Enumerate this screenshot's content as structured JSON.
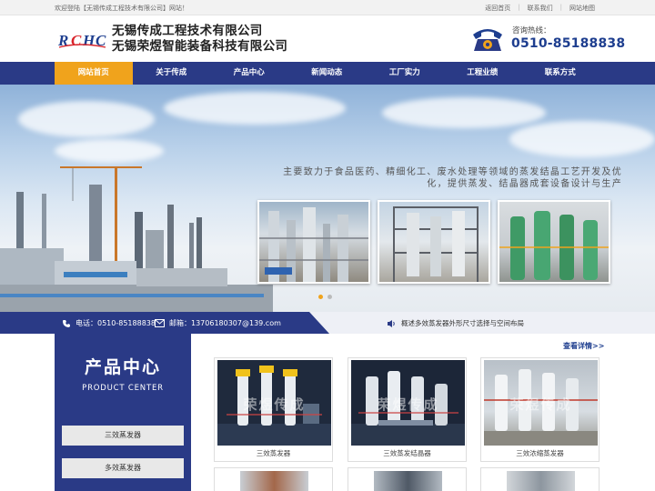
{
  "topbar": {
    "welcome": "欢迎登陆【无锡传成工程技术有限公司】网站！",
    "links": [
      "返回首页",
      "联系我们",
      "网站地图"
    ]
  },
  "header": {
    "logo_text": "RCHC",
    "company_line1": "无锡传成工程技术有限公司",
    "company_line2": "无锡荣煜智能装备科技有限公司",
    "hotline_label": "咨询热线：",
    "hotline_number": "0510-85188838"
  },
  "nav": {
    "items": [
      "网站首页",
      "关于传成",
      "产品中心",
      "新闻动态",
      "工厂实力",
      "工程业绩",
      "联系方式"
    ],
    "active_index": 0
  },
  "banner": {
    "slogan": "主要致力于食品医药、精细化工、废水处理等领域的蒸发结晶工艺开发及优化，提供蒸发、结晶器成套设备设计与生产",
    "slide_count": 2,
    "active_slide": 0
  },
  "contact_strip": {
    "tel": "电话：0510-85188838",
    "email": "邮箱：13706180307@139.com",
    "news": "概述多效蒸发器外形尺寸选择与空间布局"
  },
  "products": {
    "section_title": "产品中心",
    "section_title_en": "PRODUCT CENTER",
    "more_link": "查看详情>>",
    "categories": [
      "三效蒸发器",
      "多效蒸发器"
    ],
    "watermarks": [
      "荣煜传成",
      "荣煜传成",
      "荣煜传成"
    ],
    "items": [
      {
        "caption": "三效蒸发器"
      },
      {
        "caption": "三效蒸发结晶器"
      },
      {
        "caption": "三效浓缩蒸发器"
      }
    ]
  },
  "colors": {
    "brand_blue": "#2a3a86",
    "accent_orange": "#f0a31c",
    "logo_red": "#d8232a"
  }
}
